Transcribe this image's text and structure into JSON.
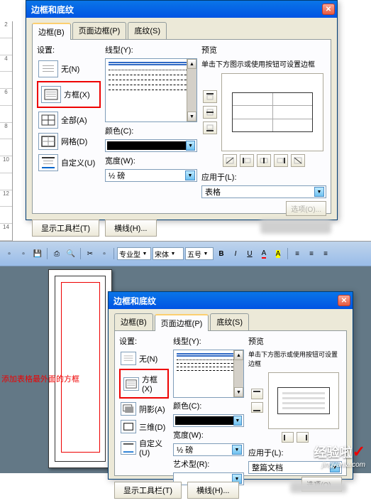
{
  "dialog": {
    "title": "边框和底纹",
    "tabs": {
      "borders": "边框(B)",
      "page_borders": "页面边框(P)",
      "shading": "底纹(S)"
    },
    "settings": {
      "label": "设置:",
      "none": "无(N)",
      "box": "方框(X)",
      "all": "全部(A)",
      "grid": "网格(D)",
      "shadow": "阴影(A)",
      "threed": "三维(D)",
      "custom": "自定义(U)"
    },
    "linetype": {
      "label": "线型(Y):",
      "color_label": "颜色(C):",
      "width_label": "宽度(W):",
      "width_value": "½ 磅",
      "art_label": "艺术型(R):"
    },
    "preview": {
      "label": "预览",
      "hint": "单击下方图示或使用按钮可设置边框",
      "apply_label": "应用于(L):",
      "apply_value_table": "表格",
      "apply_value_doc": "整篇文档",
      "options": "选项(O)..."
    },
    "buttons": {
      "toolbar": "显示工具栏(T)",
      "hline": "横线(H)..."
    }
  },
  "toolbar": {
    "style_combo": "专业型",
    "font_combo": "宋体",
    "size_combo": "五号",
    "bold": "B",
    "italic": "I",
    "underline": "U",
    "left_align": "A"
  },
  "annotation": "添加表格最外面的方框",
  "watermark": {
    "main": "经验啦",
    "sub": "jingyanla.com"
  }
}
